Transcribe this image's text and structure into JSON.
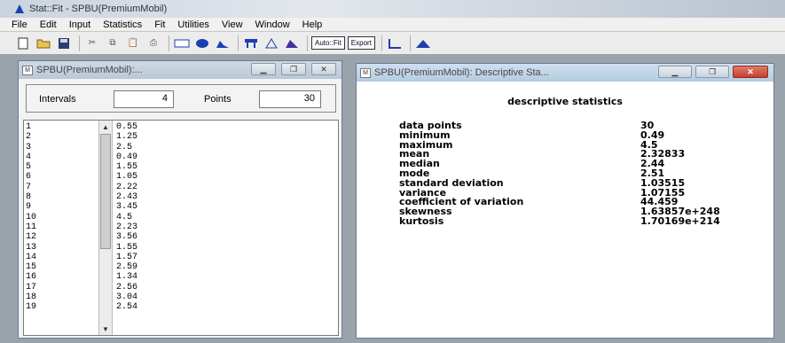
{
  "app": {
    "title": "Stat::Fit - SPBU(PremiumMobil)"
  },
  "menu": [
    "File",
    "Edit",
    "Input",
    "Statistics",
    "Fit",
    "Utilities",
    "View",
    "Window",
    "Help"
  ],
  "toolbar": {
    "autofit_label": "Auto::Fit",
    "export_label": "Export"
  },
  "data_window": {
    "title": "SPBU(PremiumMobil):...",
    "intervals_label": "Intervals",
    "intervals_value": "4",
    "points_label": "Points",
    "points_value": "30",
    "rows": [
      {
        "n": "1",
        "v": "0.55"
      },
      {
        "n": "2",
        "v": "1.25"
      },
      {
        "n": "3",
        "v": "2.5"
      },
      {
        "n": "4",
        "v": "0.49"
      },
      {
        "n": "5",
        "v": "1.55"
      },
      {
        "n": "6",
        "v": "1.05"
      },
      {
        "n": "7",
        "v": "2.22"
      },
      {
        "n": "8",
        "v": "2.43"
      },
      {
        "n": "9",
        "v": "3.45"
      },
      {
        "n": "10",
        "v": "4.5"
      },
      {
        "n": "11",
        "v": "2.23"
      },
      {
        "n": "12",
        "v": "3.56"
      },
      {
        "n": "13",
        "v": "1.55"
      },
      {
        "n": "14",
        "v": "1.57"
      },
      {
        "n": "15",
        "v": "2.59"
      },
      {
        "n": "16",
        "v": "1.34"
      },
      {
        "n": "17",
        "v": "2.56"
      },
      {
        "n": "18",
        "v": "3.04"
      },
      {
        "n": "19",
        "v": "2.54"
      }
    ]
  },
  "stats_window": {
    "title": "SPBU(PremiumMobil): Descriptive Sta...",
    "heading": "descriptive statistics",
    "rows": [
      {
        "label": "data points",
        "value": "30"
      },
      {
        "label": "minimum",
        "value": "0.49"
      },
      {
        "label": "maximum",
        "value": "4.5"
      },
      {
        "label": "mean",
        "value": "2.32833"
      },
      {
        "label": "median",
        "value": "2.44"
      },
      {
        "label": "mode",
        "value": "2.51"
      },
      {
        "label": "standard deviation",
        "value": "1.03515"
      },
      {
        "label": "variance",
        "value": "1.07155"
      },
      {
        "label": "coefficient of variation",
        "value": "44.459"
      },
      {
        "label": "skewness",
        "value": "1.63857e+248"
      },
      {
        "label": "kurtosis",
        "value": "1.70169e+214"
      }
    ]
  }
}
